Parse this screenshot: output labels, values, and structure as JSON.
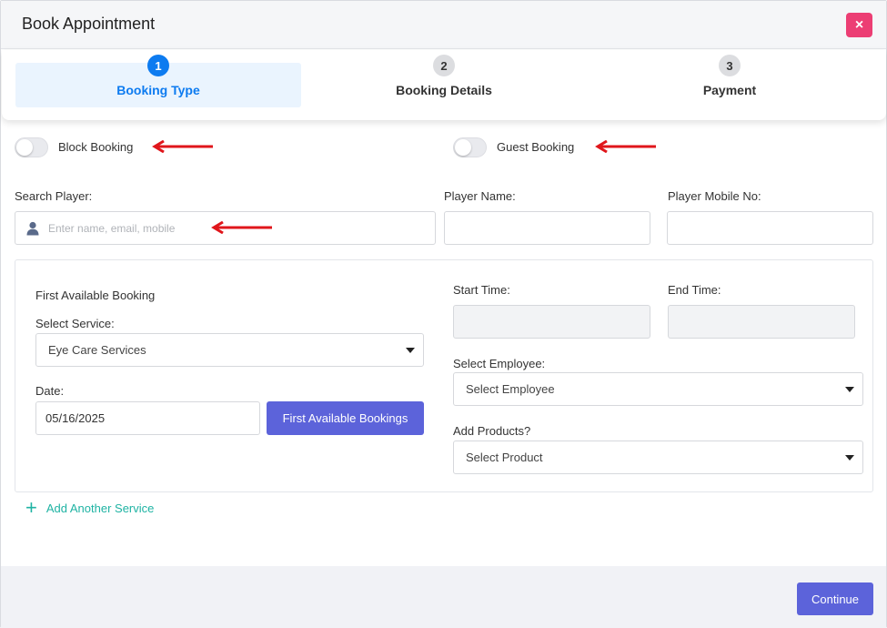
{
  "modal": {
    "title": "Book Appointment",
    "close_icon": "×"
  },
  "stepper": {
    "steps": [
      {
        "number": "1",
        "label": "Booking Type",
        "state": "active"
      },
      {
        "number": "2",
        "label": "Booking Details",
        "state": "pending"
      },
      {
        "number": "3",
        "label": "Payment",
        "state": "pending"
      }
    ]
  },
  "toggles": {
    "block_booking": {
      "label": "Block Booking",
      "checked": false
    },
    "guest_booking": {
      "label": "Guest Booking",
      "checked": false
    }
  },
  "player": {
    "search_label": "Search Player:",
    "search_placeholder": "Enter name, email, mobile",
    "name_label": "Player Name:",
    "name_value": "",
    "mobile_label": "Player Mobile No:",
    "mobile_value": ""
  },
  "service": {
    "first_available_heading": "First Available Booking",
    "select_service_label": "Select Service:",
    "select_service_value": "Eye Care Services",
    "date_label": "Date:",
    "date_value": "05/16/2025",
    "first_available_button": "First Available Bookings",
    "start_time_label": "Start Time:",
    "end_time_label": "End Time:",
    "employee_label": "Select Employee:",
    "employee_value": "Select Employee",
    "products_label": "Add Products?",
    "products_value": "Select Product"
  },
  "add_service": {
    "icon": "+",
    "label": "Add Another Service"
  },
  "footer": {
    "continue_label": "Continue"
  },
  "colors": {
    "primary": "#5c63da",
    "step_active": "#0d7bf0",
    "close": "#ec3e74",
    "add_link": "#1fb3a3",
    "annotation_arrow": "#e0161b"
  }
}
